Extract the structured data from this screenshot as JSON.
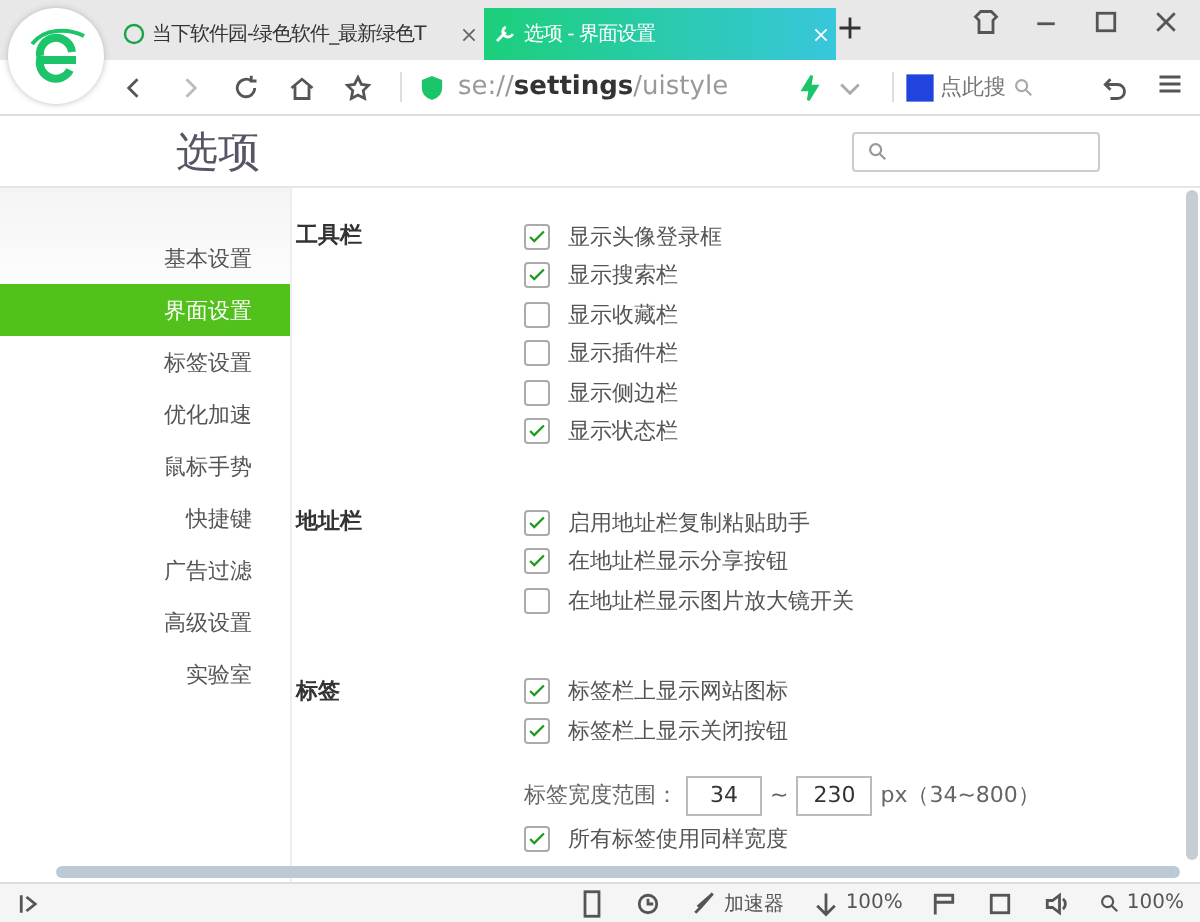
{
  "tabs": [
    {
      "label": "当下软件园-绿色软件_最新绿色T",
      "selected": false,
      "kind": "site"
    },
    {
      "label": "选项 - 界面设置",
      "selected": true,
      "kind": "settings"
    }
  ],
  "address": {
    "scheme": "se://",
    "host": "settings",
    "path": "/uistyle"
  },
  "search_box": {
    "placeholder": "点此搜"
  },
  "page_title": "选项",
  "sidebar": {
    "items": [
      {
        "label": "基本设置",
        "selected": false
      },
      {
        "label": "界面设置",
        "selected": true
      },
      {
        "label": "标签设置",
        "selected": false
      },
      {
        "label": "优化加速",
        "selected": false
      },
      {
        "label": "鼠标手势",
        "selected": false
      },
      {
        "label": "快捷键",
        "selected": false
      },
      {
        "label": "广告过滤",
        "selected": false
      },
      {
        "label": "高级设置",
        "selected": false
      },
      {
        "label": "实验室",
        "selected": false
      }
    ]
  },
  "sections": [
    {
      "title": "工具栏",
      "items": [
        {
          "kind": "checkbox",
          "label": "显示头像登录框",
          "checked": true
        },
        {
          "kind": "checkbox",
          "label": "显示搜索栏",
          "checked": true
        },
        {
          "kind": "checkbox",
          "label": "显示收藏栏",
          "checked": false
        },
        {
          "kind": "checkbox",
          "label": "显示插件栏",
          "checked": false
        },
        {
          "kind": "checkbox",
          "label": "显示侧边栏",
          "checked": false
        },
        {
          "kind": "checkbox",
          "label": "显示状态栏",
          "checked": true
        }
      ]
    },
    {
      "title": "地址栏",
      "items": [
        {
          "kind": "checkbox",
          "label": "启用地址栏复制粘贴助手",
          "checked": true
        },
        {
          "kind": "checkbox",
          "label": "在地址栏显示分享按钮",
          "checked": true
        },
        {
          "kind": "checkbox",
          "label": "在地址栏显示图片放大镜开关",
          "checked": false
        }
      ]
    },
    {
      "title": "标签",
      "items": [
        {
          "kind": "checkbox",
          "label": "标签栏上显示网站图标",
          "checked": true
        },
        {
          "kind": "checkbox",
          "label": "标签栏上显示关闭按钮",
          "checked": true
        },
        {
          "kind": "range",
          "label": "标签宽度范围：",
          "from": "34",
          "separator": "~",
          "to": "230",
          "unit": "px（34~800）"
        },
        {
          "kind": "checkbox",
          "label": "所有标签使用同样宽度",
          "checked": true
        }
      ]
    }
  ],
  "status_bar": {
    "accelerator": "加速器",
    "download": "100%",
    "zoom": "100%"
  }
}
